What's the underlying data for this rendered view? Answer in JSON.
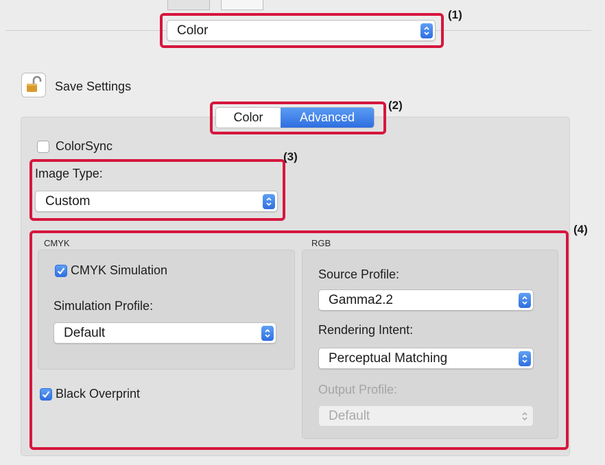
{
  "top_popup": {
    "value": "Color"
  },
  "save_settings": {
    "label": "Save Settings"
  },
  "segmented": {
    "tabs": [
      "Color",
      "Advanced"
    ],
    "selected": "Advanced"
  },
  "colorsync": {
    "label": "ColorSync",
    "checked": false
  },
  "image_type": {
    "label": "Image Type:",
    "value": "Custom"
  },
  "cmyk": {
    "header": "CMYK",
    "simulation": {
      "label": "CMYK Simulation",
      "checked": true
    },
    "profile_label": "Simulation Profile:",
    "profile_value": "Default"
  },
  "black_overprint": {
    "label": "Black Overprint",
    "checked": true
  },
  "rgb": {
    "header": "RGB",
    "source_label": "Source Profile:",
    "source_value": "Gamma2.2",
    "intent_label": "Rendering Intent:",
    "intent_value": "Perceptual Matching",
    "output_label": "Output Profile:",
    "output_value": "Default"
  },
  "callouts": [
    "(1)",
    "(2)",
    "(3)",
    "(4)"
  ],
  "colors": {
    "accent": "#2f6fe0",
    "highlight_box": "#d6163d"
  }
}
